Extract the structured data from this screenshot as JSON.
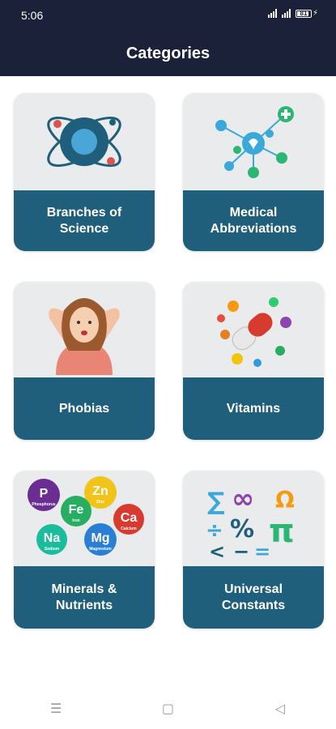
{
  "status": {
    "time": "5:06",
    "battery": "81"
  },
  "header": {
    "title": "Categories"
  },
  "categories": [
    {
      "label": "Branches of\nScience",
      "icon": "atom-icon"
    },
    {
      "label": "Medical\nAbbreviations",
      "icon": "medical-network-icon"
    },
    {
      "label": "Phobias",
      "icon": "stressed-woman-icon"
    },
    {
      "label": "Vitamins",
      "icon": "vitamin-capsule-icon"
    },
    {
      "label": "Minerals &\nNutrients",
      "icon": "mineral-elements-icon"
    },
    {
      "label": "Universal\nConstants",
      "icon": "math-symbols-icon"
    }
  ],
  "minerals": [
    {
      "symbol": "P",
      "name": "Phosphorus"
    },
    {
      "symbol": "Zn",
      "name": "Zinc"
    },
    {
      "symbol": "Fe",
      "name": "Iron"
    },
    {
      "symbol": "Ca",
      "name": "Calcium"
    },
    {
      "symbol": "Na",
      "name": "Sodium"
    },
    {
      "symbol": "Mg",
      "name": "Magnesium"
    }
  ],
  "nav": {
    "menu": "☰",
    "home": "▢",
    "back": "◁"
  },
  "colors": {
    "header": "#1a2138",
    "card_band": "#1f5f7c",
    "card_bg": "#e9ebec"
  }
}
